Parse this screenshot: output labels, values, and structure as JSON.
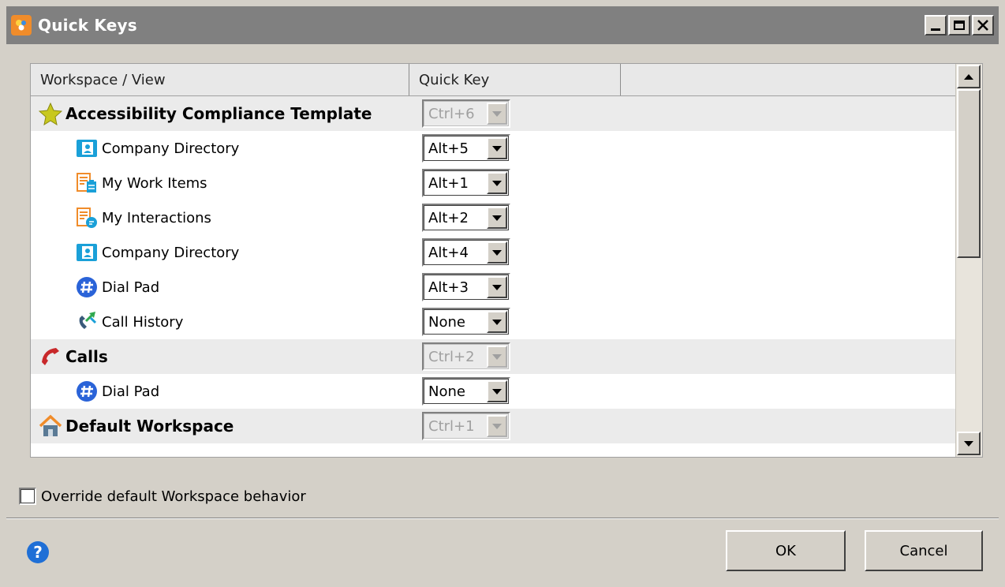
{
  "window": {
    "title": "Quick Keys",
    "controls": [
      "minimize-icon",
      "maximize-icon",
      "close-icon"
    ]
  },
  "table": {
    "columns": [
      "Workspace / View",
      "Quick Key",
      ""
    ],
    "rows": [
      {
        "type": "workspace",
        "icon": "star-icon",
        "label": "Accessibility Compliance Template",
        "key": "Ctrl+6",
        "enabled": false
      },
      {
        "type": "view",
        "icon": "company-directory-icon",
        "label": "Company Directory",
        "key": "Alt+5",
        "enabled": true
      },
      {
        "type": "view",
        "icon": "my-work-items-icon",
        "label": "My Work Items",
        "key": "Alt+1",
        "enabled": true
      },
      {
        "type": "view",
        "icon": "my-interactions-icon",
        "label": "My Interactions",
        "key": "Alt+2",
        "enabled": true
      },
      {
        "type": "view",
        "icon": "company-directory-icon",
        "label": "Company Directory",
        "key": "Alt+4",
        "enabled": true
      },
      {
        "type": "view",
        "icon": "dial-pad-icon",
        "label": "Dial Pad",
        "key": "Alt+3",
        "enabled": true
      },
      {
        "type": "view",
        "icon": "call-history-icon",
        "label": "Call History",
        "key": "None",
        "enabled": true
      },
      {
        "type": "workspace",
        "icon": "phone-icon",
        "label": "Calls",
        "key": "Ctrl+2",
        "enabled": false
      },
      {
        "type": "view",
        "icon": "dial-pad-icon",
        "label": "Dial Pad",
        "key": "None",
        "enabled": true
      },
      {
        "type": "workspace",
        "icon": "home-icon",
        "label": "Default Workspace",
        "key": "Ctrl+1",
        "enabled": false
      }
    ]
  },
  "override": {
    "label": "Override default Workspace behavior",
    "checked": false
  },
  "buttons": {
    "ok": "OK",
    "cancel": "Cancel"
  },
  "help_icon": "?"
}
